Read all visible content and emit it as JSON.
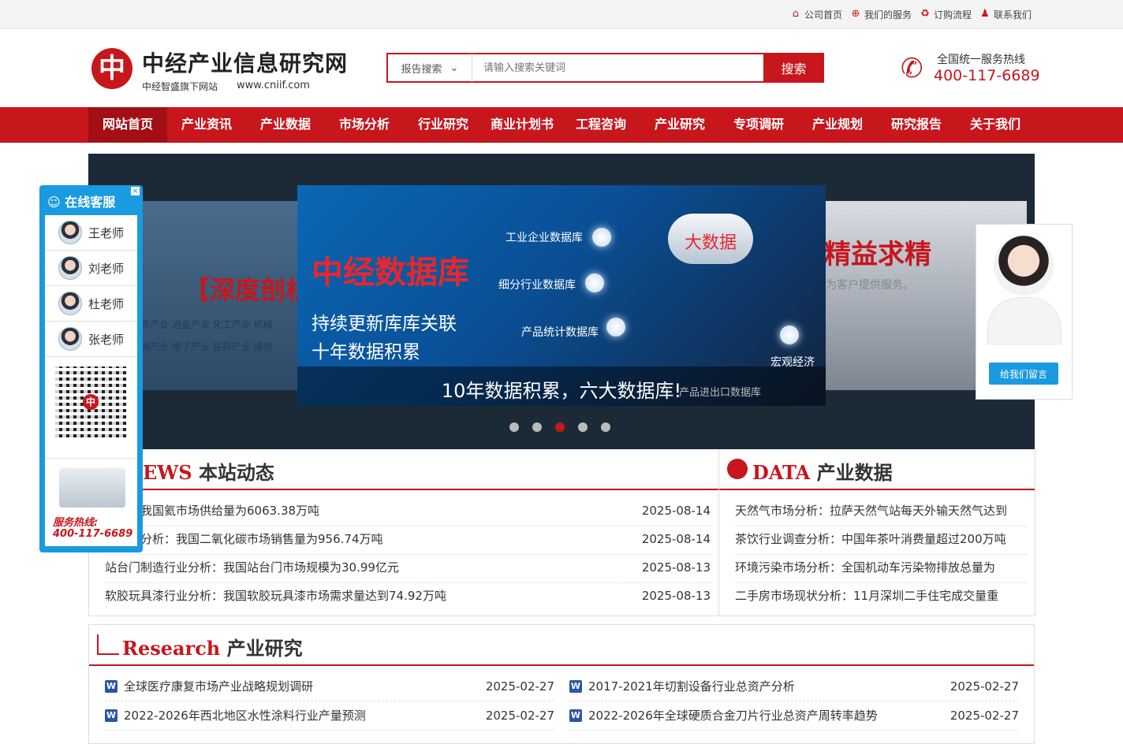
{
  "toplinks": [
    {
      "label": "公司首页",
      "icon": "home-icon"
    },
    {
      "label": "我们的服务",
      "icon": "globe-icon"
    },
    {
      "label": "订购流程",
      "icon": "recycle-icon"
    },
    {
      "label": "联系我们",
      "icon": "contacts-icon"
    }
  ],
  "logo": {
    "mark": "中",
    "name": "中经产业信息研究网",
    "sub": "中经智盛旗下网站",
    "url": "www.cniif.com"
  },
  "search": {
    "type": "报告搜索",
    "placeholder": "请输入搜索关键词",
    "button": "搜索"
  },
  "hotline": {
    "label": "全国统一服务热线",
    "number": "400-117-6689"
  },
  "nav": [
    "网站首页",
    "产业资讯",
    "产业数据",
    "市场分析",
    "行业研究",
    "商业计划书",
    "工程咨询",
    "产业研究",
    "专项调研",
    "产业规划",
    "研究报告",
    "关于我们"
  ],
  "banner": {
    "left_big": "【深度剖析",
    "left_line1": "原产业  冶金产业  化工产业  机械",
    "left_line2": "通产业  电子产业  医药产业  通信",
    "right_big": "精益求精",
    "right_small": "为客户提供服务。",
    "main_title": "中经数据库",
    "main_sub1": "持续更新库库关联",
    "main_sub2": "十年数据积累",
    "cloud": "大数据",
    "db1": "工业企业数据库",
    "db2": "细分行业数据库",
    "db3": "产品统计数据库",
    "db4": "宏观经济",
    "db5": "产品进出口数据库",
    "caption": "10年数据积累，六大数据库!",
    "slide_count": 5,
    "active_slide": 2
  },
  "news": {
    "title_en": "EWS",
    "title_cn": "本站动态",
    "items": [
      {
        "text": "分析：我国氦市场供给量为6063.38万吨",
        "date": "2025-08-14"
      },
      {
        "text": "碳行业分析：我国二氧化碳市场销售量为956.74万吨",
        "date": "2025-08-14"
      },
      {
        "text": "站台门制造行业分析：我国站台门市场规模为30.99亿元",
        "date": "2025-08-13"
      },
      {
        "text": "软胶玩具漆行业分析：我国软胶玩具漆市场需求量达到74.92万吨",
        "date": "2025-08-13"
      }
    ]
  },
  "data": {
    "title_en": "DATA",
    "title_cn": "产业数据",
    "items": [
      "天然气市场分析：拉萨天然气站每天外输天然气达到",
      "茶饮行业调查分析：中国年茶叶消费量超过200万吨",
      "环境污染市场分析：全国机动车污染物排放总量为",
      "二手房市场现状分析：11月深圳二手住宅成交量重"
    ]
  },
  "research": {
    "title_en": "Research",
    "title_cn": "产业研究",
    "items": [
      {
        "text": "全球医疗康复市场产业战略规划调研",
        "date": "2025-02-27"
      },
      {
        "text": "2017-2021年切割设备行业总资产分析",
        "date": "2025-02-27"
      },
      {
        "text": "2022-2026年西北地区水性涂料行业产量预测",
        "date": "2025-02-27"
      },
      {
        "text": "2022-2026年全球硬质合金刀片行业总资产周转率趋势",
        "date": "2025-02-27"
      }
    ]
  },
  "service": {
    "title": "在线客服",
    "agents": [
      "王老师",
      "刘老师",
      "杜老师",
      "张老师"
    ],
    "hotline_label": "服务热线:",
    "hotline_number": "400-117-6689"
  },
  "message": {
    "button": "给我们留言"
  }
}
